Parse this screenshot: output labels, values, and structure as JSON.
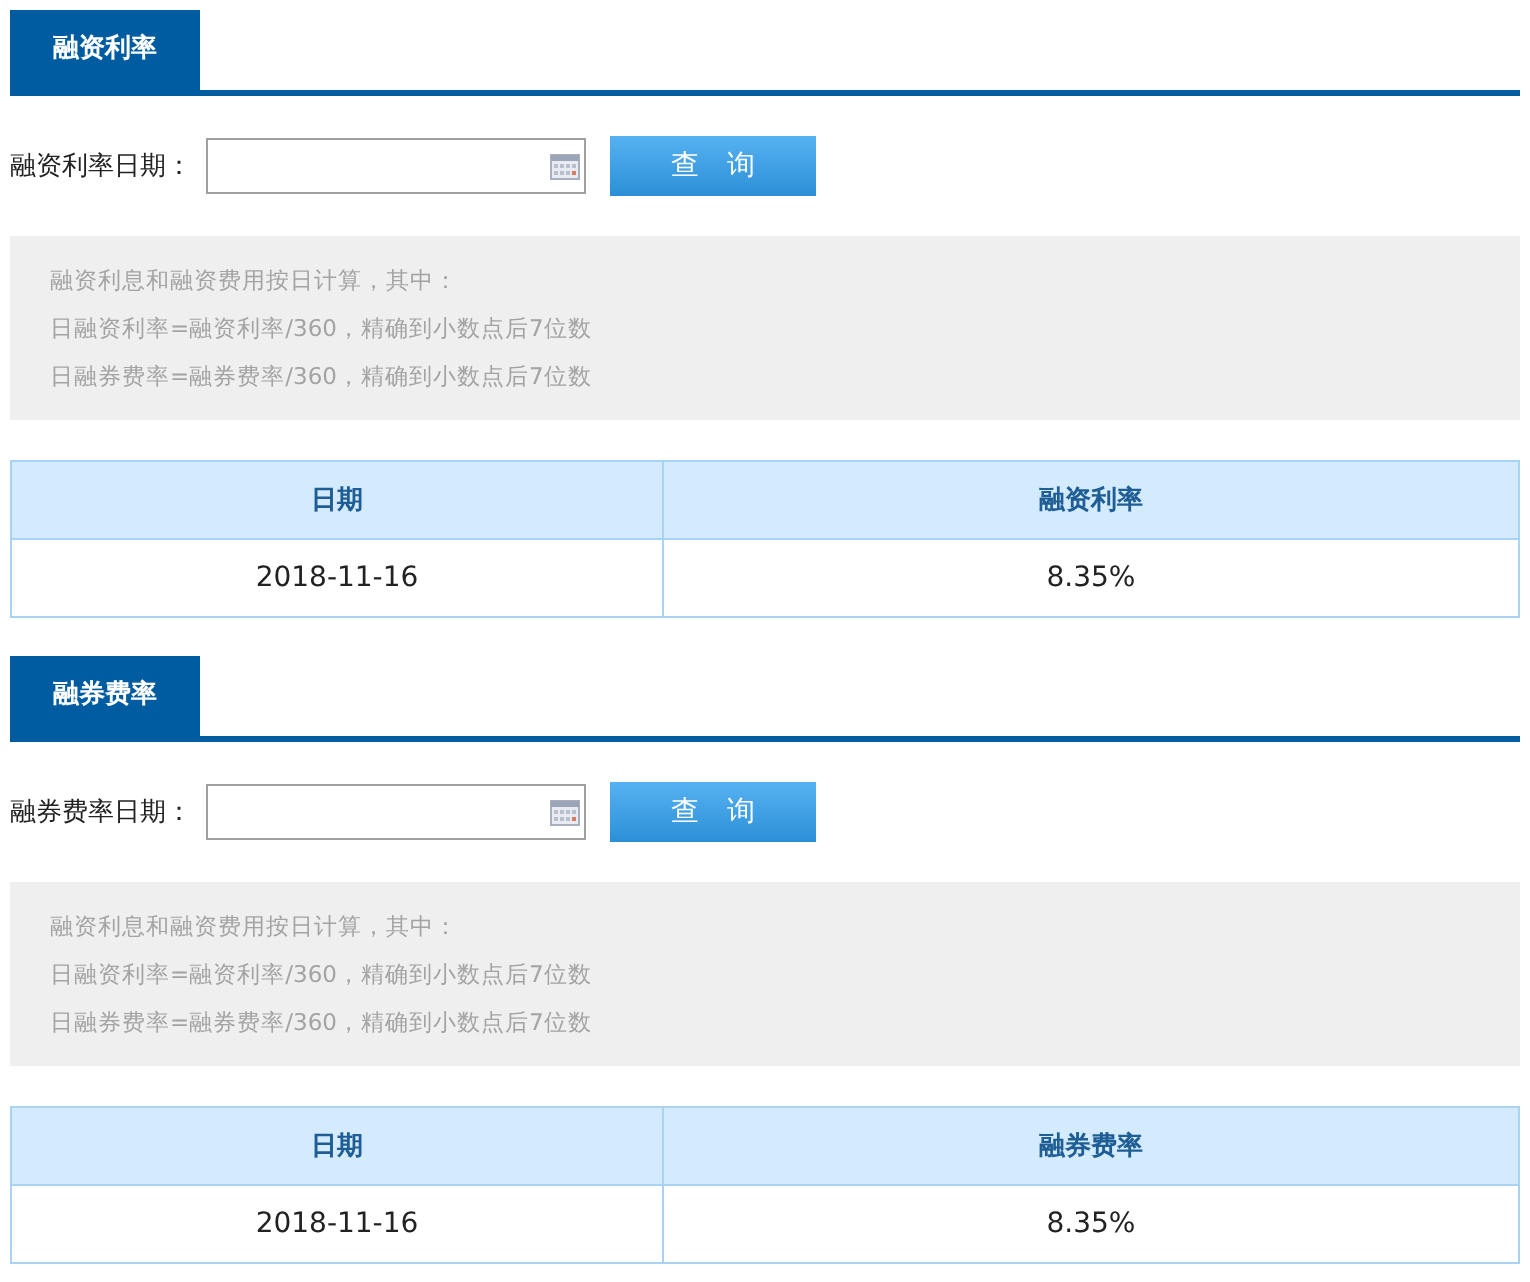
{
  "sections": [
    {
      "title": "融资利率",
      "query": {
        "label": "融资利率日期：",
        "button": "查　询"
      },
      "notes": [
        "融资利息和融资费用按日计算，其中：",
        "日融资利率=融资利率/360，精确到小数点后7位数",
        "日融券费率=融券费率/360，精确到小数点后7位数"
      ],
      "table": {
        "columns": [
          "日期",
          "融资利率"
        ],
        "rows": [
          [
            "2018-11-16",
            "8.35%"
          ]
        ]
      }
    },
    {
      "title": "融券费率",
      "query": {
        "label": "融券费率日期：",
        "button": "查　询"
      },
      "notes": [
        "融资利息和融资费用按日计算，其中：",
        "日融资利率=融资利率/360，精确到小数点后7位数",
        "日融券费率=融券费率/360，精确到小数点后7位数"
      ],
      "table": {
        "columns": [
          "日期",
          "融券费率"
        ],
        "rows": [
          [
            "2018-11-16",
            "8.35%"
          ]
        ]
      }
    }
  ]
}
